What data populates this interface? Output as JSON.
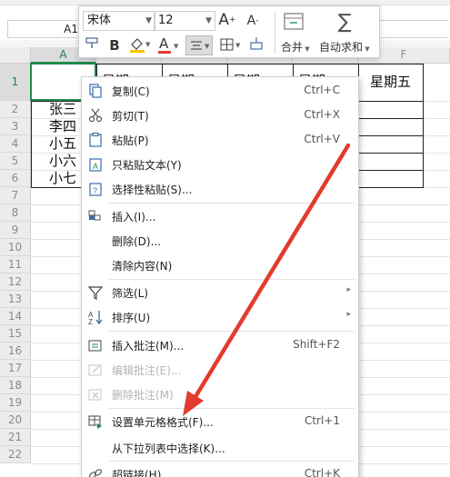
{
  "name_box": {
    "value": "A1"
  },
  "mini_toolbar": {
    "font_name": "宋体",
    "font_size": "12",
    "grow_font_label": "A",
    "shrink_font_label": "A",
    "bold_label": "B",
    "font_color_label": "A",
    "merge_label": "合并",
    "autosum_label": "自动求和",
    "autosum_symbol": "∑",
    "accent_color": "#e33b2e"
  },
  "columns": [
    {
      "label": "A",
      "selected": true
    },
    {
      "label": "B",
      "selected": false
    },
    {
      "label": "C",
      "selected": false
    },
    {
      "label": "D",
      "selected": false
    },
    {
      "label": "E",
      "selected": false
    },
    {
      "label": "F",
      "selected": false
    }
  ],
  "rows": [
    "1",
    "2",
    "3",
    "4",
    "5",
    "6",
    "7",
    "8",
    "9",
    "10",
    "11",
    "12",
    "13",
    "14",
    "15",
    "16",
    "17",
    "18",
    "19",
    "20",
    "21",
    "22"
  ],
  "cells": {
    "header_fragments": [
      "星期",
      "星期",
      "星期",
      "星期"
    ],
    "f1": "星期五",
    "a2": "张三",
    "a3": "李四",
    "a4": "小五",
    "a5": "小六",
    "a6": "小七"
  },
  "context_menu": {
    "items": [
      {
        "label": "复制(C)",
        "shortcut": "Ctrl+C",
        "icon": "copy-icon"
      },
      {
        "label": "剪切(T)",
        "shortcut": "Ctrl+X",
        "icon": "scissors-icon"
      },
      {
        "label": "粘贴(P)",
        "shortcut": "Ctrl+V",
        "icon": "paste-icon"
      },
      {
        "label": "只粘贴文本(Y)",
        "shortcut": "",
        "icon": "paste-text-icon"
      },
      {
        "label": "选择性粘贴(S)...",
        "shortcut": "",
        "icon": "paste-special-icon"
      },
      {
        "label": "插入(I)...",
        "shortcut": "",
        "icon": "insert-icon"
      },
      {
        "label": "删除(D)...",
        "shortcut": "",
        "icon": ""
      },
      {
        "label": "清除内容(N)",
        "shortcut": "",
        "icon": ""
      },
      {
        "label": "筛选(L)",
        "shortcut": "",
        "icon": "filter-icon",
        "submenu": true
      },
      {
        "label": "排序(U)",
        "shortcut": "",
        "icon": "sort-icon",
        "submenu": true
      },
      {
        "label": "插入批注(M)...",
        "shortcut": "Shift+F2",
        "icon": "insert-comment-icon"
      },
      {
        "label": "编辑批注(E)...",
        "shortcut": "",
        "icon": "edit-comment-icon",
        "disabled": true
      },
      {
        "label": "删除批注(M)",
        "shortcut": "",
        "icon": "delete-comment-icon",
        "disabled": true
      },
      {
        "label": "设置单元格格式(F)...",
        "shortcut": "Ctrl+1",
        "icon": "format-cells-icon"
      },
      {
        "label": "从下拉列表中选择(K)...",
        "shortcut": "",
        "icon": ""
      },
      {
        "label": "超链接(H)...",
        "shortcut": "Ctrl+K",
        "icon": "hyperlink-icon"
      }
    ]
  },
  "annotation": {
    "arrow_color": "#e33b2e"
  }
}
